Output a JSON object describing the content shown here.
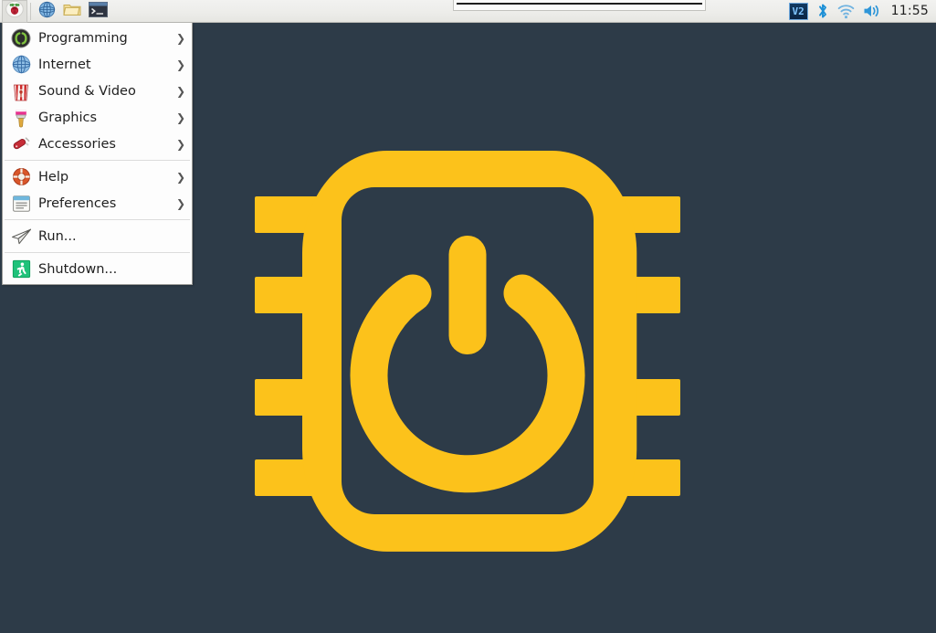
{
  "desktop": {
    "background_color": "#2d3b48",
    "accent_color": "#fcc21b",
    "wallpaper_icon": "cpu-chip-power-icon",
    "wallpaper_description": "Yellow integrated-circuit chip outline with power symbol inside"
  },
  "taskbar": {
    "background_color": "#ededea",
    "launchers": [
      {
        "name": "menu-button",
        "icon": "raspberry-pi-icon",
        "label": ""
      },
      {
        "name": "web-browser-launcher",
        "icon": "globe-icon",
        "label": ""
      },
      {
        "name": "file-manager-launcher",
        "icon": "folder-icon",
        "label": ""
      },
      {
        "name": "terminal-launcher",
        "icon": "terminal-icon",
        "label": ""
      }
    ],
    "window_buttons": [
      {
        "title": "",
        "active": false
      }
    ],
    "tray": [
      {
        "name": "vnc-server-icon",
        "label": "V2"
      },
      {
        "name": "bluetooth-icon",
        "label": ""
      },
      {
        "name": "wifi-icon",
        "label": ""
      },
      {
        "name": "volume-icon",
        "label": ""
      }
    ],
    "clock": "11:55"
  },
  "menu": {
    "title": "",
    "items": [
      {
        "label": "Programming",
        "icon": "programming-icon",
        "submenu": true,
        "separator_after": false
      },
      {
        "label": "Internet",
        "icon": "internet-globe-icon",
        "submenu": true,
        "separator_after": false
      },
      {
        "label": "Sound & Video",
        "icon": "sound-video-icon",
        "submenu": true,
        "separator_after": false
      },
      {
        "label": "Graphics",
        "icon": "graphics-paintbrush-icon",
        "submenu": true,
        "separator_after": false
      },
      {
        "label": "Accessories",
        "icon": "accessories-knife-icon",
        "submenu": true,
        "separator_after": true
      },
      {
        "label": "Help",
        "icon": "help-lifebuoy-icon",
        "submenu": true,
        "separator_after": false
      },
      {
        "label": "Preferences",
        "icon": "preferences-list-icon",
        "submenu": true,
        "separator_after": true
      },
      {
        "label": "Run...",
        "icon": "run-paper-plane-icon",
        "submenu": false,
        "separator_after": true
      },
      {
        "label": "Shutdown...",
        "icon": "shutdown-exit-icon",
        "submenu": false,
        "separator_after": false
      }
    ],
    "submenu_arrow": "❯"
  }
}
